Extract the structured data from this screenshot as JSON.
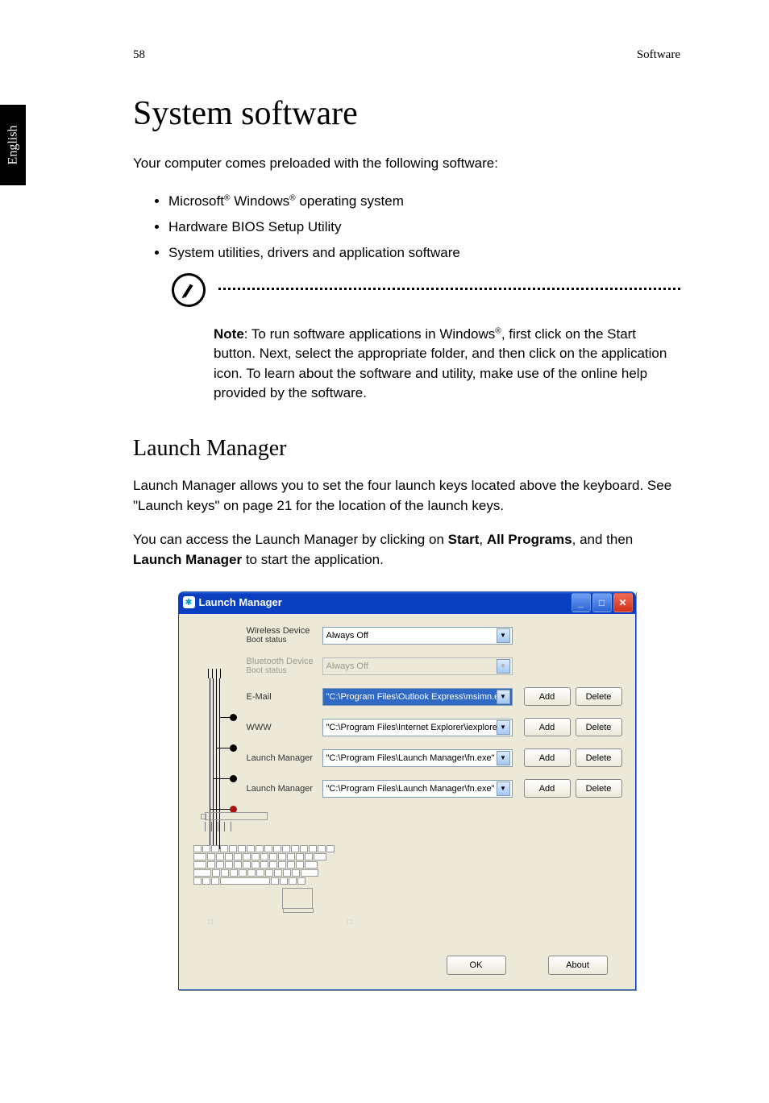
{
  "header": {
    "page_number": "58",
    "section": "Software"
  },
  "side_tab": "English",
  "h1": "System software",
  "intro": "Your computer comes preloaded with the following software:",
  "bullets": {
    "b1_pre": "Microsoft",
    "b1_mid": " Windows",
    "b1_post": " operating system",
    "b2": "Hardware BIOS Setup Utility",
    "b3": "System utilities, drivers and application software"
  },
  "note": {
    "label": "Note",
    "text_pre": ": To run software applications in Windows",
    "text_post": ", first click on the Start button. Next, select the appropriate folder, and then click on the application icon. To learn about the software and utility, make use of the online help provided by the software."
  },
  "h2": "Launch Manager",
  "lm_p1": "Launch Manager allows you to set the four launch keys located above the keyboard. See \"Launch keys\" on page 21 for the location of the launch keys.",
  "lm_p2_a": "You can access the Launch Manager by clicking on ",
  "lm_p2_b": "Start",
  "lm_p2_c": ", ",
  "lm_p2_d": "All Programs",
  "lm_p2_e": ", and then ",
  "lm_p2_f": "Launch Manager",
  "lm_p2_g": " to start the application.",
  "window": {
    "title": "Launch Manager",
    "rows": {
      "wireless": {
        "label": "Wireless Device",
        "sub": "Boot status",
        "value": "Always Off"
      },
      "bluetooth": {
        "label": "Bluetooth Device",
        "sub": "Boot status",
        "value": "Always Off"
      },
      "email": {
        "label": "E-Mail",
        "value": "\"C:\\Program Files\\Outlook Express\\msimn.ex"
      },
      "www": {
        "label": "WWW",
        "value": "\"C:\\Program Files\\Internet Explorer\\iexplore.e"
      },
      "lm1": {
        "label": "Launch Manager",
        "value": "\"C:\\Program Files\\Launch Manager\\fn.exe\""
      },
      "lm2": {
        "label": "Launch Manager",
        "value": "\"C:\\Program Files\\Launch Manager\\fn.exe\""
      }
    },
    "btn_add": "Add",
    "btn_delete": "Delete",
    "btn_ok": "OK",
    "btn_about": "About"
  },
  "reg_symbol": "®"
}
